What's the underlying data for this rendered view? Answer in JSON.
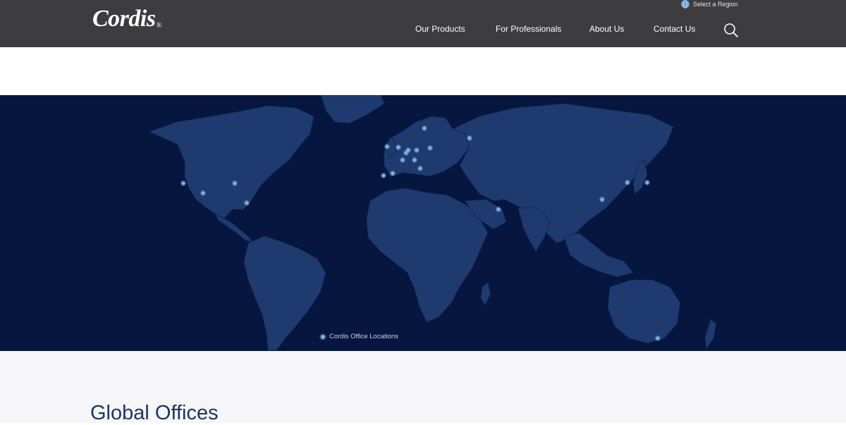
{
  "header": {
    "logo_text": "Cordis",
    "logo_mark": "®",
    "region_label": "Select a Region",
    "nav": [
      {
        "label": "Our Products"
      },
      {
        "label": "For Professionals"
      },
      {
        "label": "About Us"
      },
      {
        "label": "Contact Us"
      }
    ],
    "search_icon": "search-icon"
  },
  "map": {
    "legend_label": "Cordis Office Locations",
    "land_color": "#1f3a6e",
    "ocean_color": "#06163f",
    "marker_color": "#7fb0e6"
  },
  "section": {
    "title": "Global Offices"
  }
}
